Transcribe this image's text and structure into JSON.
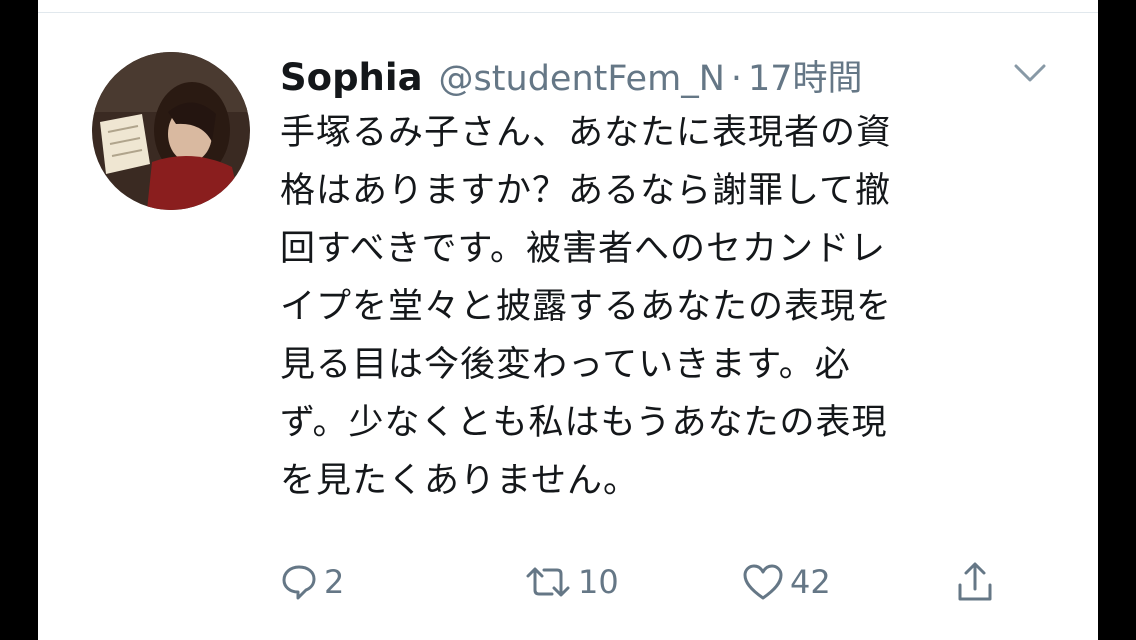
{
  "tweet": {
    "author_name": "Sophia",
    "handle": "@studentFem_N",
    "separator": "·",
    "time_ago": "17時間",
    "text_lines": [
      "手塚るみ子さん、あなたに表現者の資",
      "格はありますか？あるなら謝罪して撤",
      "回すべきです。被害者へのセカンドレ",
      "イプを堂々と披露するあなたの表現を",
      "見る目は今後変わっていきます。必",
      "ず。少なくとも私はもうあなたの表現",
      "を見たくありません。"
    ],
    "replies": "2",
    "retweets": "10",
    "likes": "42"
  },
  "icons": {
    "reply": "speech-bubble-icon",
    "retweet": "retweet-arrows-icon",
    "like": "heart-icon",
    "share": "share-arrow-icon",
    "menu": "chevron-down-icon"
  },
  "colors": {
    "text": "#14171a",
    "secondary": "#657786",
    "background": "#ffffff"
  }
}
